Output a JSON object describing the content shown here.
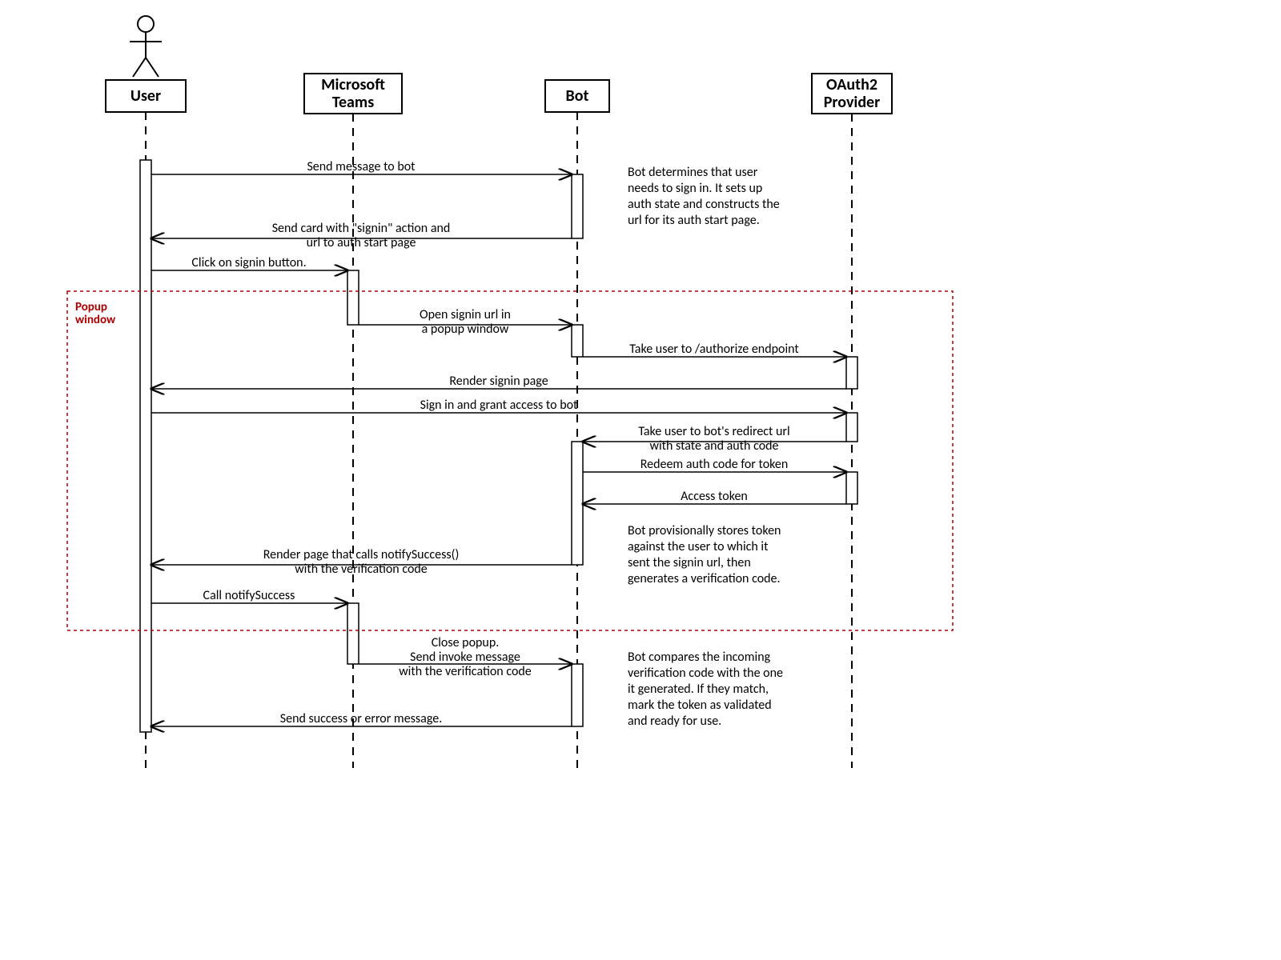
{
  "participants": [
    {
      "id": "user",
      "label": "User"
    },
    {
      "id": "teams",
      "label_line1": "Microsoft",
      "label_line2": "Teams"
    },
    {
      "id": "bot",
      "label": "Bot"
    },
    {
      "id": "oauth",
      "label_line1": "OAuth2",
      "label_line2": "Provider"
    }
  ],
  "messages": {
    "m1": "Send message to bot",
    "m2a": "Send card with \"signin\" action and",
    "m2b": "url to auth start page",
    "m3": "Click on signin button.",
    "m4a": "Open signin url in",
    "m4b": "a popup window",
    "m5": "Take user to /authorize endpoint",
    "m6": "Render signin page",
    "m7": "Sign in and grant access to bot",
    "m8a": "Take user to bot's redirect url",
    "m8b": "with state and auth code",
    "m9": "Redeem auth code for token",
    "m10": "Access token",
    "m11a": "Render page that calls notifySuccess()",
    "m11b": "with the verification code",
    "m12": "Call notifySuccess",
    "m13a": "Close popup.",
    "m13b": "Send invoke message",
    "m13c": "with the verification code",
    "m14": "Send success or error message."
  },
  "notes": {
    "n1a": "Bot determines that user",
    "n1b": "needs to sign in. It sets up",
    "n1c": "auth state and constructs the",
    "n1d": "url for its auth start page.",
    "n2a": "Bot provisionally stores token",
    "n2b": "against the user to which it",
    "n2c": "sent the signin url, then",
    "n2d": "generates a verification code.",
    "n3a": "Bot compares the incoming",
    "n3b": "verification code with the one",
    "n3c": "it generated. If they match,",
    "n3d": "mark the token as validated",
    "n3e": "and ready for use."
  },
  "popup_label_a": "Popup",
  "popup_label_b": "window"
}
